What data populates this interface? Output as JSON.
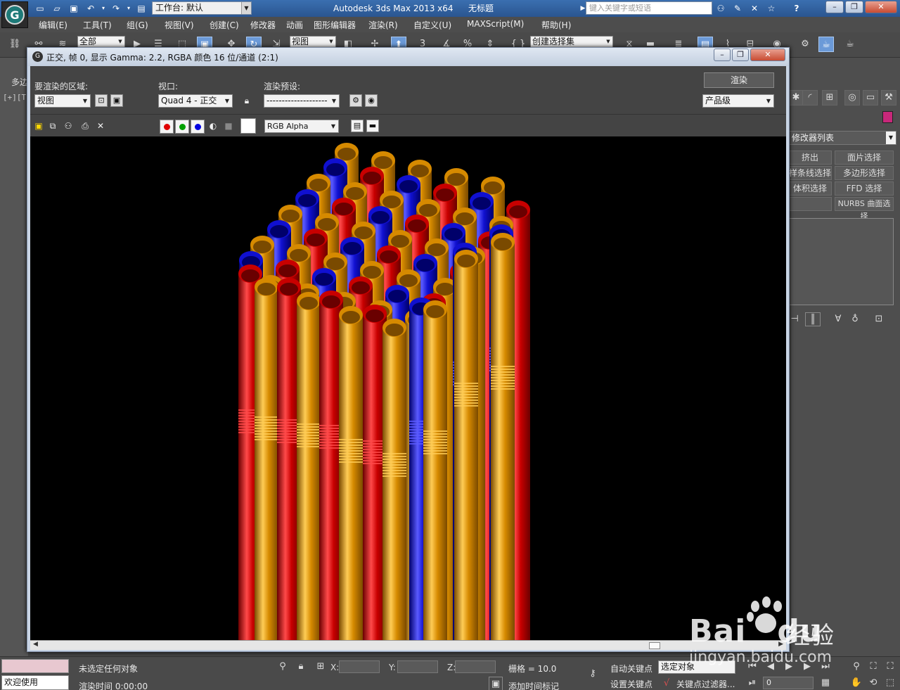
{
  "app": {
    "logo_letter": "G",
    "workspace_label": "工作台: 默认",
    "title_app": "Autodesk 3ds Max  2013 x64",
    "title_doc": "无标题",
    "search_placeholder": "键入关键字或短语",
    "help_icon": "?"
  },
  "menu": [
    "编辑(E)",
    "工具(T)",
    "组(G)",
    "视图(V)",
    "创建(C)",
    "修改器",
    "动画",
    "图形编辑器",
    "渲染(R)",
    "自定义(U)",
    "MAXScript(M)",
    "帮助(H)"
  ],
  "toolbar": {
    "selection_filter": "全部",
    "ref_coord": "视图",
    "named_selection": "创建选择集"
  },
  "left_panel": {
    "tab_label": "多边",
    "viewport_label": "[+][T"
  },
  "render_window": {
    "title": "正交, 帧 0, 显示 Gamma: 2.2, RGBA 颜色 16 位/通道 (2:1)",
    "area_label": "要渲染的区域:",
    "area_value": "视图",
    "viewport_label": "视口:",
    "viewport_value": "Quad 4 - 正交",
    "preset_label": "渲染预设:",
    "preset_value": "--------------------",
    "render_button": "渲染",
    "quality_value": "产品级",
    "channel_value": "RGB Alpha",
    "channel_colors": {
      "red": "#e00000",
      "green": "#00a000",
      "blue": "#0000e0"
    },
    "scene_colors": {
      "red": "#c80000",
      "blue": "#1010d0",
      "orange": "#d68a00"
    }
  },
  "command_panel": {
    "modifier_list": "修改器列表",
    "buttons": [
      "挤出",
      "面片选择",
      "样条线选择",
      "多边形选择",
      "体积选择",
      "FFD 选择",
      "",
      "NURBS 曲面选择"
    ]
  },
  "status": {
    "maxscript_text": "欢迎使用 MAXSc",
    "selection_status": "未选定任何对象",
    "render_time": "渲染时间  0:00:00",
    "x_label": "X:",
    "y_label": "Y:",
    "z_label": "Z:",
    "grid": "栅格 = 10.0",
    "add_time_tag": "添加时间标记",
    "auto_key": "自动关键点",
    "set_key": "设置关键点",
    "selected_set": "选定对象",
    "key_filters": "关键点过滤器...",
    "frame": "0"
  },
  "watermark": {
    "brand": "Bai",
    "brand2": "du",
    "jingyan": "经验",
    "url": "jingyan.baidu.com"
  }
}
